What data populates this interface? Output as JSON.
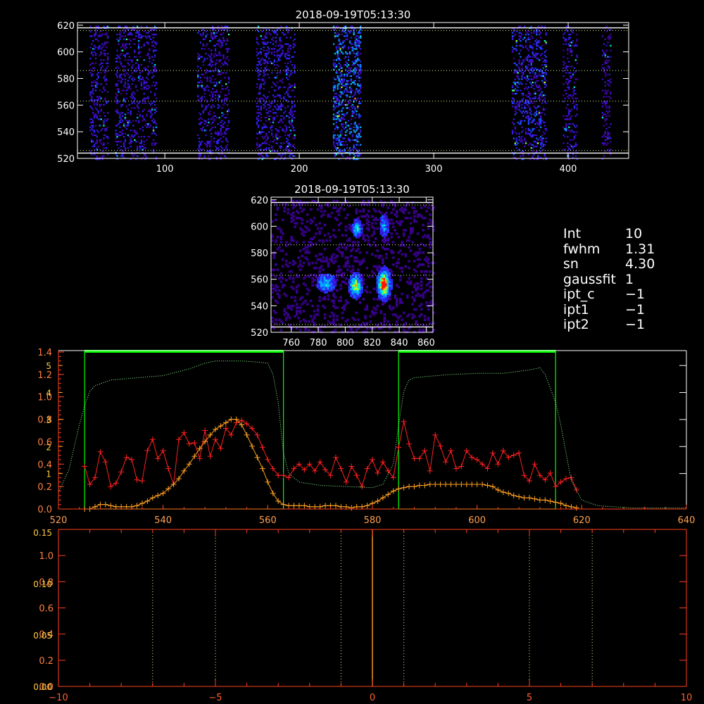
{
  "chart_data": [
    {
      "type": "heatmap",
      "title": "2018-09-19T05:13:30",
      "xlim": [
        35,
        445
      ],
      "ylim": [
        520,
        622
      ],
      "xticks": [
        100,
        200,
        300,
        400
      ],
      "yticks": [
        520,
        540,
        560,
        580,
        600,
        620
      ],
      "colormap": "rainbow",
      "column_bands": [
        [
          44,
          58
        ],
        [
          63,
          94
        ],
        [
          124,
          148
        ],
        [
          168,
          197
        ],
        [
          225,
          246
        ],
        [
          358,
          384
        ],
        [
          396,
          407
        ],
        [
          425,
          432
        ]
      ],
      "band_intensity": [
        0.45,
        0.45,
        0.45,
        0.5,
        0.85,
        0.6,
        0.45,
        0.3
      ],
      "hlines_white": [
        618,
        524
      ],
      "hlines_dotted": [
        616,
        586,
        563,
        526
      ]
    },
    {
      "type": "heatmap",
      "title": "2018-09-19T05:13:30",
      "xlim": [
        745,
        865
      ],
      "ylim": [
        520,
        622
      ],
      "xticks": [
        760,
        780,
        800,
        820,
        840,
        860
      ],
      "yticks": [
        520,
        540,
        560,
        580,
        600,
        620
      ],
      "colormap": "rainbow",
      "blobs": [
        {
          "x": 828,
          "y": 556,
          "sx": 2.5,
          "sy": 6,
          "peak": 1.0
        },
        {
          "x": 807,
          "y": 555,
          "sx": 2.5,
          "sy": 5,
          "peak": 0.7
        },
        {
          "x": 785,
          "y": 557,
          "sx": 4,
          "sy": 4,
          "peak": 0.4
        },
        {
          "x": 808,
          "y": 598,
          "sx": 2,
          "sy": 4,
          "peak": 0.45
        },
        {
          "x": 828,
          "y": 600,
          "sx": 2,
          "sy": 5,
          "peak": 0.35
        }
      ],
      "hlines_white": [
        618,
        524
      ],
      "hlines_dotted": [
        616,
        586,
        563,
        526
      ]
    },
    {
      "type": "line",
      "xlim": [
        520,
        640
      ],
      "ylim": [
        0,
        1.4
      ],
      "xticks": [
        520,
        540,
        560,
        580,
        600,
        620,
        640
      ],
      "yticks": [
        0.0,
        0.2,
        0.4,
        0.6,
        0.8,
        1.0,
        1.2,
        1.4
      ],
      "yticks_secondary": [
        1,
        2,
        3,
        4,
        5
      ],
      "windows": [
        [
          525,
          563
        ],
        [
          585,
          615
        ]
      ],
      "series": [
        {
          "color": "#ff2020",
          "marker": "plus",
          "x": [
            525,
            526,
            527,
            528,
            529,
            530,
            531,
            532,
            533,
            534,
            535,
            536,
            537,
            538,
            539,
            540,
            541,
            542,
            543,
            544,
            545,
            546,
            547,
            548,
            549,
            550,
            551,
            552,
            553,
            554,
            555,
            556,
            557,
            558,
            559,
            560,
            561,
            562,
            563,
            564,
            565,
            566,
            567,
            568,
            569,
            570,
            571,
            572,
            573,
            574,
            575,
            576,
            577,
            578,
            579,
            580,
            581,
            582,
            583,
            584,
            585,
            586,
            587,
            588,
            589,
            590,
            591,
            592,
            593,
            594,
            595,
            596,
            597,
            598,
            599,
            600,
            601,
            602,
            603,
            604,
            605,
            606,
            607,
            608,
            609,
            610,
            611,
            612,
            613,
            614,
            615,
            616,
            617,
            618,
            619
          ],
          "values": [
            0.38,
            0.22,
            0.28,
            0.51,
            0.42,
            0.2,
            0.23,
            0.33,
            0.46,
            0.44,
            0.26,
            0.25,
            0.52,
            0.62,
            0.45,
            0.52,
            0.36,
            0.22,
            0.62,
            0.68,
            0.58,
            0.59,
            0.45,
            0.7,
            0.47,
            0.62,
            0.54,
            0.72,
            0.66,
            0.77,
            0.79,
            0.76,
            0.72,
            0.66,
            0.55,
            0.44,
            0.36,
            0.3,
            0.3,
            0.28,
            0.36,
            0.4,
            0.35,
            0.4,
            0.34,
            0.42,
            0.35,
            0.3,
            0.46,
            0.36,
            0.24,
            0.38,
            0.3,
            0.2,
            0.36,
            0.44,
            0.32,
            0.42,
            0.34,
            0.28,
            0.55,
            0.78,
            0.58,
            0.45,
            0.45,
            0.52,
            0.34,
            0.66,
            0.56,
            0.42,
            0.52,
            0.36,
            0.38,
            0.52,
            0.46,
            0.44,
            0.4,
            0.36,
            0.5,
            0.4,
            0.52,
            0.46,
            0.48,
            0.5,
            0.3,
            0.25,
            0.4,
            0.3,
            0.26,
            0.32,
            0.2,
            0.24,
            0.27,
            0.28,
            0.17
          ]
        },
        {
          "color": "#ffa020",
          "marker": "plus",
          "x": [
            525,
            526,
            527,
            528,
            529,
            530,
            531,
            532,
            533,
            534,
            535,
            536,
            537,
            538,
            539,
            540,
            541,
            542,
            543,
            544,
            545,
            546,
            547,
            548,
            549,
            550,
            551,
            552,
            553,
            554,
            555,
            556,
            557,
            558,
            559,
            560,
            561,
            562,
            563,
            564,
            565,
            566,
            567,
            568,
            569,
            570,
            571,
            572,
            573,
            574,
            575,
            576,
            577,
            578,
            579,
            580,
            581,
            582,
            583,
            584,
            585,
            586,
            587,
            588,
            589,
            590,
            591,
            592,
            593,
            594,
            595,
            596,
            597,
            598,
            599,
            600,
            601,
            602,
            603,
            604,
            605,
            606,
            607,
            608,
            609,
            610,
            611,
            612,
            613,
            614,
            615,
            616,
            617,
            618,
            619
          ],
          "values": [
            0.0,
            0.0,
            0.02,
            0.04,
            0.04,
            0.03,
            0.02,
            0.02,
            0.02,
            0.02,
            0.03,
            0.05,
            0.07,
            0.1,
            0.12,
            0.14,
            0.18,
            0.22,
            0.27,
            0.34,
            0.4,
            0.47,
            0.54,
            0.6,
            0.66,
            0.71,
            0.74,
            0.77,
            0.8,
            0.8,
            0.75,
            0.66,
            0.56,
            0.46,
            0.36,
            0.24,
            0.14,
            0.07,
            0.04,
            0.03,
            0.03,
            0.03,
            0.03,
            0.02,
            0.02,
            0.02,
            0.03,
            0.03,
            0.03,
            0.02,
            0.02,
            0.01,
            0.02,
            0.02,
            0.03,
            0.05,
            0.07,
            0.1,
            0.13,
            0.16,
            0.18,
            0.19,
            0.2,
            0.2,
            0.21,
            0.21,
            0.22,
            0.22,
            0.22,
            0.22,
            0.22,
            0.22,
            0.22,
            0.22,
            0.22,
            0.22,
            0.22,
            0.21,
            0.2,
            0.17,
            0.15,
            0.14,
            0.12,
            0.11,
            0.1,
            0.1,
            0.09,
            0.08,
            0.08,
            0.07,
            0.06,
            0.05,
            0.03,
            0.02,
            0.01
          ]
        },
        {
          "color": "#90ff90",
          "style": "dotted",
          "x": [
            520,
            522,
            523,
            524,
            525,
            526,
            527,
            530,
            535,
            540,
            545,
            548,
            550,
            555,
            558,
            560,
            561,
            562,
            563,
            564,
            566,
            570,
            575,
            580,
            582,
            584,
            585,
            586,
            587,
            588,
            590,
            595,
            600,
            605,
            610,
            612,
            613,
            614,
            615,
            616,
            617,
            618,
            620,
            623,
            626,
            630,
            635,
            640
          ],
          "values": [
            0.15,
            0.35,
            0.55,
            0.75,
            0.92,
            1.05,
            1.1,
            1.15,
            1.17,
            1.19,
            1.25,
            1.3,
            1.32,
            1.32,
            1.31,
            1.3,
            1.2,
            0.95,
            0.5,
            0.32,
            0.24,
            0.21,
            0.2,
            0.19,
            0.22,
            0.4,
            0.75,
            1.05,
            1.15,
            1.17,
            1.18,
            1.2,
            1.21,
            1.21,
            1.24,
            1.26,
            1.2,
            1.08,
            0.95,
            0.75,
            0.5,
            0.25,
            0.08,
            0.03,
            0.02,
            0.01,
            0.01,
            0.01
          ]
        }
      ]
    },
    {
      "type": "line",
      "xlim": [
        -10,
        10
      ],
      "ylim": [
        0,
        1.2
      ],
      "xticks": [
        -10,
        -5,
        0,
        5,
        10
      ],
      "yticks": [
        0.0,
        0.2,
        0.4,
        0.6,
        0.8,
        1.0
      ],
      "yticks_secondary": [
        0.0,
        0.05,
        0.1,
        0.15
      ],
      "ylim_secondary": [
        0,
        0.15
      ],
      "vlines_dotted": [
        -7,
        -5,
        -1,
        1,
        5,
        7
      ],
      "vline_solid": 0
    }
  ],
  "info_panel": {
    "lines": [
      {
        "label": "Int",
        "value": "10"
      },
      {
        "label": "fwhm",
        "value": "1.31"
      },
      {
        "label": "sn",
        "value": "4.30"
      },
      {
        "label": "gaussfit",
        "value": "1"
      },
      {
        "label": "ipt_c",
        "value": "−1"
      },
      {
        "label": "ipt1",
        "value": "−1"
      },
      {
        "label": "ipt2",
        "value": "−1"
      }
    ]
  }
}
